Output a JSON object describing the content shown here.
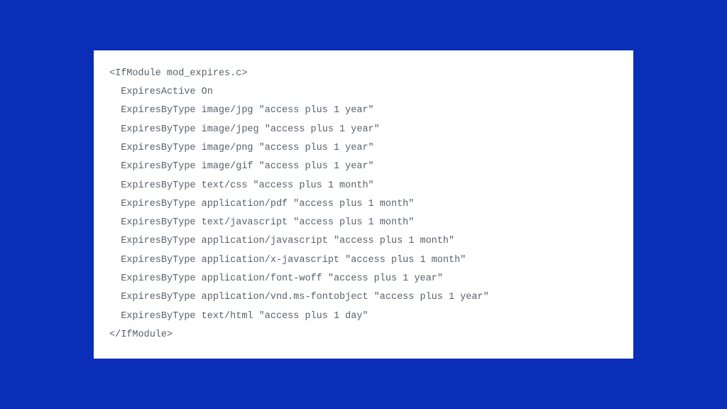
{
  "code": {
    "lines": [
      "<IfModule mod_expires.c>",
      "  ExpiresActive On",
      "  ExpiresByType image/jpg \"access plus 1 year\"",
      "  ExpiresByType image/jpeg \"access plus 1 year\"",
      "  ExpiresByType image/png \"access plus 1 year\"",
      "  ExpiresByType image/gif \"access plus 1 year\"",
      "  ExpiresByType text/css \"access plus 1 month\"",
      "  ExpiresByType application/pdf \"access plus 1 month\"",
      "  ExpiresByType text/javascript \"access plus 1 month\"",
      "  ExpiresByType application/javascript \"access plus 1 month\"",
      "  ExpiresByType application/x-javascript \"access plus 1 month\"",
      "  ExpiresByType application/font-woff \"access plus 1 year\"",
      "  ExpiresByType application/vnd.ms-fontobject \"access plus 1 year\"",
      "  ExpiresByType text/html \"access plus 1 day\"",
      "</IfModule>"
    ]
  }
}
